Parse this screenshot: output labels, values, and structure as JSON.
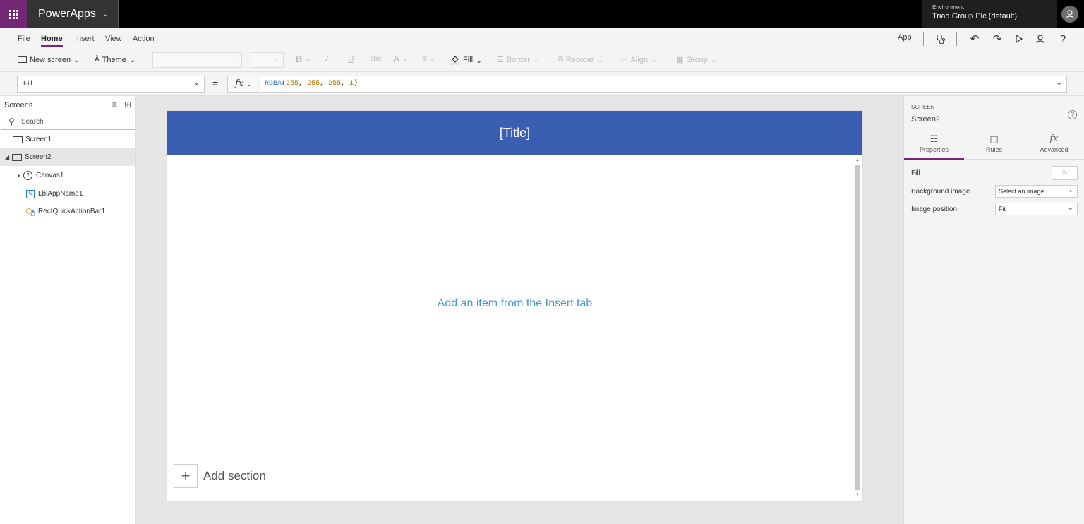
{
  "app": {
    "name": "PowerApps"
  },
  "environment": {
    "label": "Environment",
    "value": "Triad Group Plc (default)"
  },
  "menu": {
    "tabs": [
      "File",
      "Home",
      "Insert",
      "View",
      "Action"
    ],
    "active_tab": "Home",
    "app_label": "App"
  },
  "toolbar": {
    "new_screen": "New screen",
    "theme": "Theme",
    "fill": "Fill",
    "border": "Border",
    "reorder": "Reorder",
    "align": "Align",
    "group": "Group"
  },
  "formula": {
    "property": "Fill",
    "fx": "fx",
    "fn": "RGBA",
    "args": [
      "255",
      "255",
      "255",
      "1"
    ]
  },
  "tree": {
    "title": "Screens",
    "search_placeholder": "Search",
    "items": [
      {
        "label": "Screen1"
      },
      {
        "label": "Screen2"
      },
      {
        "label": "Canvas1"
      },
      {
        "label": "LblAppName1"
      },
      {
        "label": "RectQuickActionBar1"
      }
    ]
  },
  "canvas": {
    "title": "[Title]",
    "placeholder": "Add an item from the Insert tab",
    "add_section": "Add section",
    "header_color": "#3a5fb2"
  },
  "properties": {
    "type": "SCREEN",
    "name": "Screen2",
    "tabs": [
      "Properties",
      "Rules",
      "Advanced"
    ],
    "active_tab": "Properties",
    "fill_label": "Fill",
    "background_image_label": "Background image",
    "background_image_value": "Select an image...",
    "image_position_label": "Image position",
    "image_position_value": "Fit"
  }
}
